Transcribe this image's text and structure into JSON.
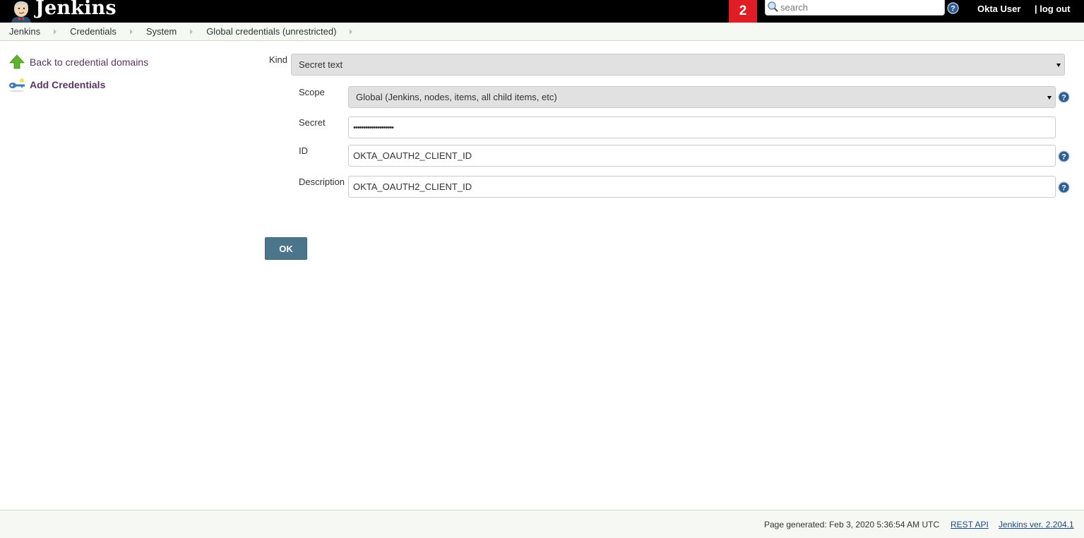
{
  "header": {
    "logo_text": "Jenkins",
    "notification_count": "2",
    "search": {
      "placeholder": "search",
      "value": ""
    },
    "user_name": "Okta User",
    "logout_label": "| log out"
  },
  "breadcrumb": {
    "items": [
      {
        "label": "Jenkins"
      },
      {
        "label": "Credentials"
      },
      {
        "label": "System"
      },
      {
        "label": "Global credentials (unrestricted)"
      }
    ]
  },
  "side_panel": {
    "tasks": [
      {
        "label": "Back to credential domains",
        "icon": "up-arrow-icon"
      },
      {
        "label": "Add Credentials",
        "icon": "key-icon"
      }
    ]
  },
  "form": {
    "kind": {
      "label": "Kind",
      "value": "Secret text"
    },
    "scope": {
      "label": "Scope",
      "value": "Global (Jenkins, nodes, items, all child items, etc)"
    },
    "secret": {
      "label": "Secret",
      "value": "••••••••••••••••••••"
    },
    "id": {
      "label": "ID",
      "value": "OKTA_OAUTH2_CLIENT_ID"
    },
    "description": {
      "label": "Description",
      "value": "OKTA_OAUTH2_CLIENT_ID"
    },
    "ok_label": "OK"
  },
  "footer": {
    "generated": "Page generated: Feb 3, 2020 5:36:54 AM UTC",
    "rest_api": "REST API",
    "version": "Jenkins ver. 2.204.1"
  },
  "colors": {
    "header_bg": "#000000",
    "notification_bg": "#e01c24",
    "link_purple": "#5c3566",
    "ok_button": "#4b758b",
    "footer_link": "#204a87"
  }
}
